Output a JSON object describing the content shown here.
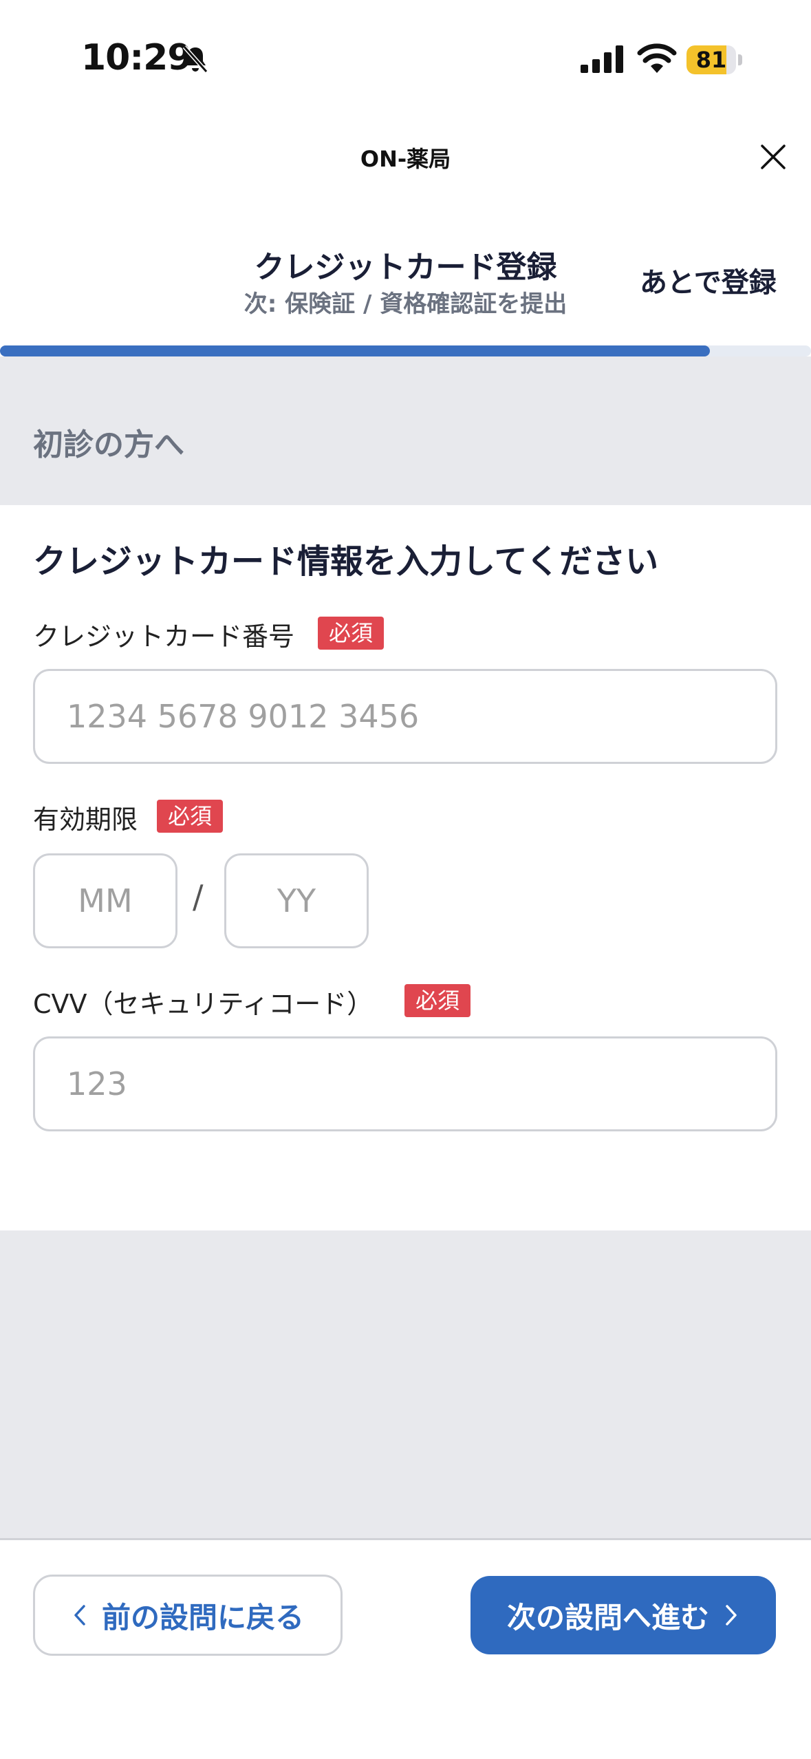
{
  "status_bar": {
    "time": "10:29",
    "battery": "81",
    "battery_level": 0.81
  },
  "header": {
    "app_name": "ON-薬局",
    "step_title": "クレジットカード登録",
    "step_subtitle": "次: 保険証 / 資格確認証を提出",
    "later_label": "あとで登録",
    "progress": 0.875
  },
  "section": {
    "label": "初診の方へ"
  },
  "form": {
    "title": "クレジットカード情報を入力してください",
    "required_badge": "必須",
    "card_number": {
      "label": "クレジットカード番号",
      "placeholder": "1234 5678 9012 3456",
      "value": ""
    },
    "expiry": {
      "label": "有効期限",
      "month_placeholder": "MM",
      "separator": "/",
      "year_placeholder": "YY"
    },
    "cvv": {
      "label": "CVV（セキュリティコード）",
      "placeholder": "123",
      "value": ""
    }
  },
  "footer": {
    "back_label": "前の設問に戻る",
    "next_label": "次の設問へ進む"
  },
  "colors": {
    "accent": "#2f6abf",
    "required": "#e0464f",
    "background_grey": "#e8e9ed",
    "battery": "#f4c22b"
  }
}
